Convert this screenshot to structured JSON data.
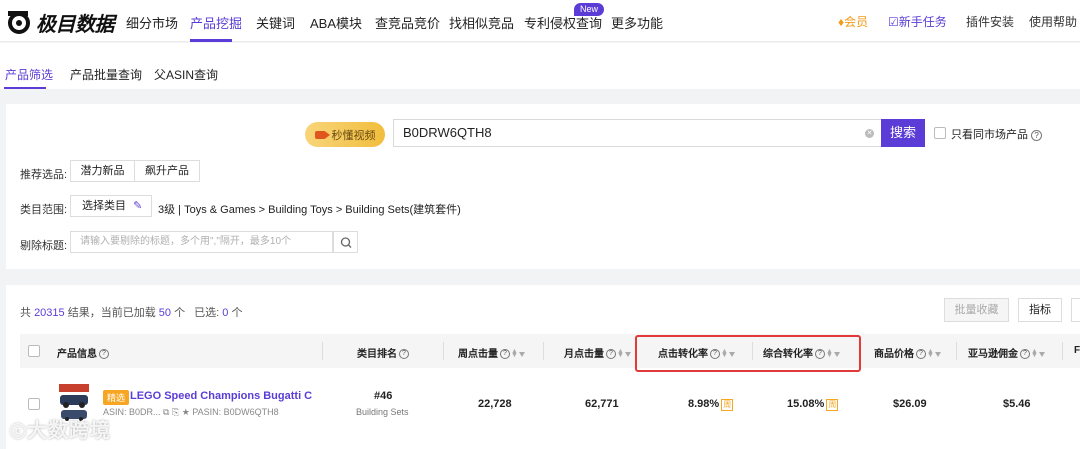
{
  "brand": {
    "name": "极目数据",
    "accent": "#5b3cd6"
  },
  "nav": {
    "items": [
      "细分市场",
      "产品挖掘",
      "关键词",
      "ABA模块",
      "查竞品竞价",
      "找相似竞品",
      "专利侵权查询",
      "更多功能"
    ],
    "active": "产品挖掘",
    "new_badge": "New"
  },
  "topright": {
    "member": "会员",
    "tasks": "新手任务",
    "plugin": "插件安装",
    "help": "使用帮助"
  },
  "subtabs": [
    "产品筛选",
    "产品批量查询",
    "父ASIN查询"
  ],
  "search": {
    "video_label": "秒懂视频",
    "value": "B0DRW6QTH8",
    "button": "搜索",
    "same_market_label": "只看同市场产品"
  },
  "filters": {
    "recommend_label": "推荐选品:",
    "recommend_options": [
      "潜力新品",
      "飙升产品"
    ],
    "category_label": "类目范围:",
    "category_button": "选择类目",
    "category_path": "3级 | Toys & Games > Building Toys > Building Sets(建筑套件)",
    "exclude_label": "剔除标题:",
    "exclude_placeholder": "请输入要剔除的标题，多个用\",\"隔开，最多10个"
  },
  "results": {
    "prefix": "共",
    "total": "20315",
    "mid": "结果，当前已加载",
    "loaded": "50",
    "unit": "个",
    "selected_label": "已选:",
    "selected": "0",
    "batch_fav": "批量收藏",
    "metrics": "指标"
  },
  "table": {
    "columns": [
      "产品信息",
      "类目排名",
      "周点击量",
      "月点击量",
      "点击转化率",
      "综合转化率",
      "商品价格",
      "亚马逊佣金",
      "F"
    ],
    "rows": [
      {
        "tag": "精选",
        "title": "LEGO Speed Champions Bugatti C...",
        "asin": "ASIN: B0DR...",
        "pasin": "PASIN: B0DW6QTH8",
        "rank": "#46",
        "rank_category": "Building Sets",
        "weekly_clicks": "22,728",
        "monthly_clicks": "62,771",
        "click_cvr": "8.98%",
        "overall_cvr": "15.08%",
        "week_tag": "周",
        "price": "$26.09",
        "commission": "$5.46"
      }
    ]
  },
  "watermark": "大数跨境",
  "icons": [
    "logo-icon",
    "video-camera-icon",
    "clear-icon",
    "search-icon",
    "edit-icon",
    "help-icon",
    "sort-icon",
    "filter-icon",
    "copy-icon",
    "star-icon",
    "crown-icon",
    "task-icon"
  ]
}
